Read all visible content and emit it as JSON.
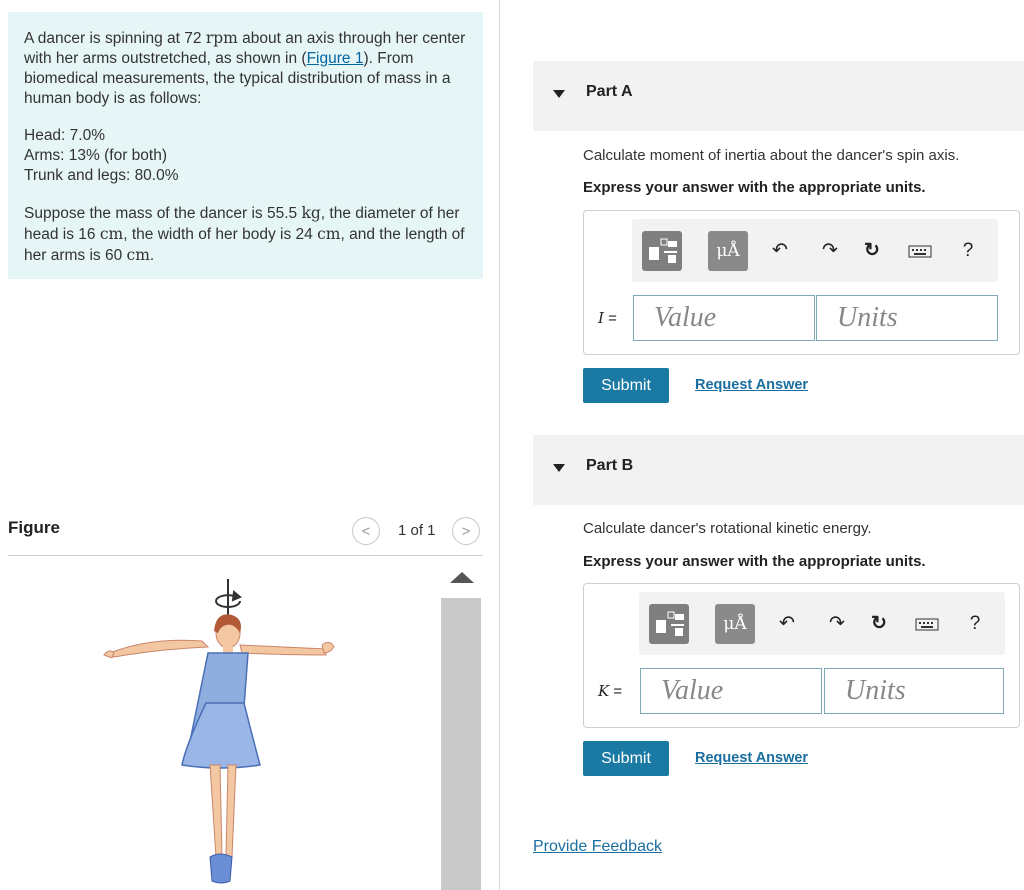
{
  "problem": {
    "p1_a": "A dancer is spinning at 72 ",
    "p1_unit_rpm": "rpm",
    "p1_b": " about an axis through her center with her arms outstretched, as shown in (",
    "p1_link": "Figure 1",
    "p1_c": "). From biomedical measurements, the typical distribution of mass in a human body is as follows:",
    "head": "Head: 7.0%",
    "arms": "Arms: 13% (for both)",
    "trunk": "Trunk and legs: 80.0%",
    "p3_a": "Suppose the mass of the dancer is 55.5 ",
    "p3_kg": "kg",
    "p3_b": ", the diameter of her head is 16 ",
    "p3_cm1": "cm",
    "p3_c": ", the width of her body is 24 ",
    "p3_cm2": "cm",
    "p3_d": ", and the length of her arms is 60 ",
    "p3_cm3": "cm",
    "p3_e": "."
  },
  "figure": {
    "title": "Figure",
    "pager_text": "1 of 1",
    "prev": "<",
    "next": ">"
  },
  "partA": {
    "title": "Part A",
    "question": "Calculate moment of inertia about the dancer's spin axis.",
    "instruction": "Express your answer with the appropriate units.",
    "var_label": "I",
    "eq": " =",
    "value_placeholder": "Value",
    "units_placeholder": "Units",
    "submit": "Submit",
    "request": "Request Answer"
  },
  "partB": {
    "title": "Part B",
    "question": "Calculate dancer's rotational kinetic energy.",
    "instruction": "Express your answer with the appropriate units.",
    "var_label": "K",
    "eq": " =",
    "value_placeholder": "Value",
    "units_placeholder": "Units",
    "submit": "Submit",
    "request": "Request Answer"
  },
  "toolbar": {
    "mu_label": "μÅ",
    "undo": "↶",
    "redo": "↷",
    "reset": "↻",
    "help": "?"
  },
  "feedback": "Provide Feedback",
  "colors": {
    "accent": "#1b7aa4",
    "problem_bg": "#e6f5f5",
    "link": "#1b6ea0"
  }
}
